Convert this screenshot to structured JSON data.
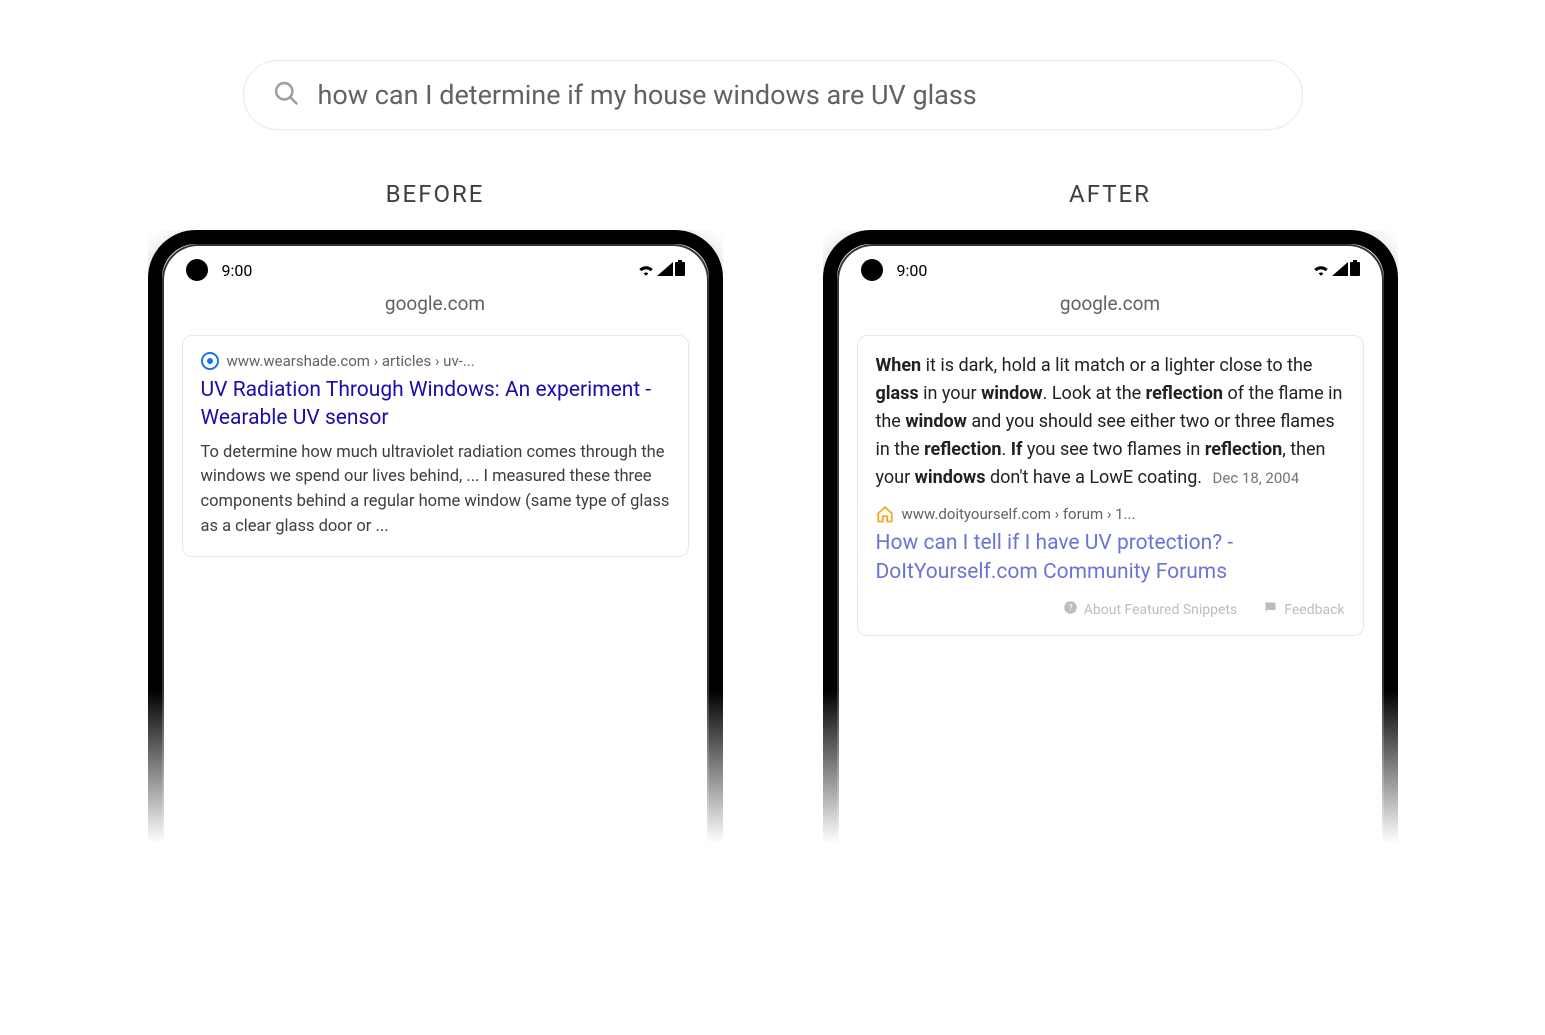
{
  "search": {
    "query": "how can I determine if my house windows are UV glass"
  },
  "labels": {
    "before": "BEFORE",
    "after": "AFTER"
  },
  "phone": {
    "time": "9:00",
    "address": "google.com"
  },
  "before_result": {
    "breadcrumb": "www.wearshade.com › articles › uv-...",
    "title": "UV Radiation Through Windows: An experiment - Wearable UV sensor",
    "snippet": "To determine how much ultraviolet radiation comes through the windows we spend our lives behind, ... I measured these three components behind a regular home window (same type of glass as a clear glass door or  ..."
  },
  "after_result": {
    "snippet_parts": [
      {
        "b": true,
        "t": "When"
      },
      {
        "b": false,
        "t": " it is dark, hold a lit match or a lighter close to the "
      },
      {
        "b": true,
        "t": "glass"
      },
      {
        "b": false,
        "t": " in your "
      },
      {
        "b": true,
        "t": "window"
      },
      {
        "b": false,
        "t": ". Look at the "
      },
      {
        "b": true,
        "t": "reflection"
      },
      {
        "b": false,
        "t": " of the flame in the "
      },
      {
        "b": true,
        "t": "window"
      },
      {
        "b": false,
        "t": " and you should see either two or three flames in the "
      },
      {
        "b": true,
        "t": "reflection"
      },
      {
        "b": false,
        "t": ". "
      },
      {
        "b": true,
        "t": "If"
      },
      {
        "b": false,
        "t": " you see two flames in "
      },
      {
        "b": true,
        "t": "reflection"
      },
      {
        "b": false,
        "t": ", then your "
      },
      {
        "b": true,
        "t": "windows"
      },
      {
        "b": false,
        "t": " don't have a LowE coating."
      }
    ],
    "date": "Dec 18, 2004",
    "breadcrumb": "www.doityourself.com › forum › 1...",
    "title": "How can I tell if I have UV protection? - DoItYourself.com Community Forums",
    "about_label": "About Featured Snippets",
    "feedback_label": "Feedback"
  }
}
